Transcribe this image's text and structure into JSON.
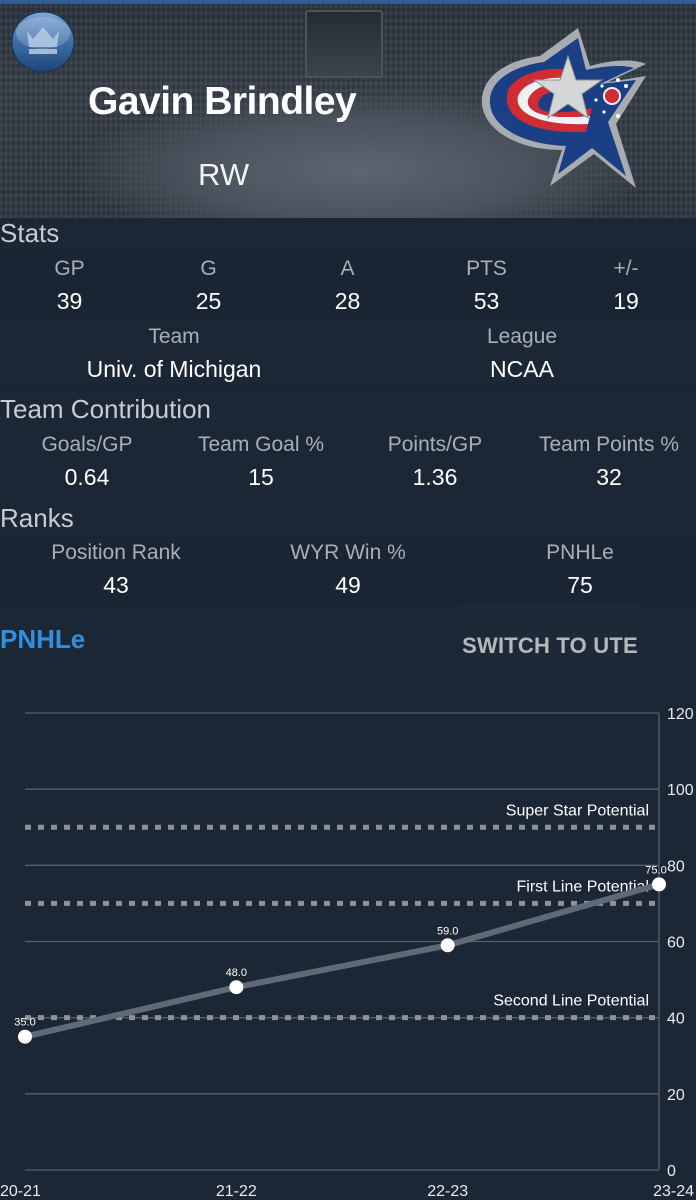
{
  "player": {
    "name": "Gavin Brindley",
    "position": "RW"
  },
  "app": {
    "logo_icon": "crown-puck-icon",
    "team_logo_icon": "columbus-blue-jackets-logo"
  },
  "stats": {
    "title": "Stats",
    "columns": [
      {
        "label": "GP",
        "value": "39"
      },
      {
        "label": "G",
        "value": "25"
      },
      {
        "label": "A",
        "value": "28"
      },
      {
        "label": "PTS",
        "value": "53"
      },
      {
        "label": "+/-",
        "value": "19"
      }
    ],
    "team_label": "Team",
    "team_value": "Univ. of Michigan",
    "league_label": "League",
    "league_value": "NCAA"
  },
  "contribution": {
    "title": "Team Contribution",
    "columns": [
      {
        "label": "Goals/GP",
        "value": "0.64"
      },
      {
        "label": "Team Goal %",
        "value": "15"
      },
      {
        "label": "Points/GP",
        "value": "1.36"
      },
      {
        "label": "Team Points %",
        "value": "32"
      }
    ]
  },
  "ranks": {
    "title": "Ranks",
    "columns": [
      {
        "label": "Position Rank",
        "value": "43"
      },
      {
        "label": "WYR Win %",
        "value": "49"
      },
      {
        "label": "PNHLe",
        "value": "75"
      }
    ]
  },
  "tabs": {
    "active": "PNHLe",
    "switch_label": "SWITCH TO UTE"
  },
  "colors": {
    "background": "#1c2735",
    "accent": "#2f8fe0",
    "line": "#5e6a76",
    "reference": "#8e9296"
  },
  "chart_data": {
    "type": "line",
    "title": "PNHLe",
    "categories": [
      "20-21",
      "21-22",
      "22-23",
      "23-24"
    ],
    "series": [
      {
        "name": "PNHLe",
        "values": [
          35.0,
          48.0,
          59.0,
          75.0
        ],
        "labels": [
          "35.0",
          "48.0",
          "59.0",
          "75.0"
        ]
      }
    ],
    "reference_lines": [
      {
        "name": "Super Star Potential",
        "value": 90
      },
      {
        "name": "First Line Potential",
        "value": 70
      },
      {
        "name": "Second Line Potential",
        "value": 40
      }
    ],
    "yticks": [
      0,
      20,
      40,
      60,
      80,
      100,
      120
    ],
    "ylim": [
      0,
      120
    ],
    "xlabel": "",
    "ylabel": "",
    "y_axis_side": "right",
    "grid": true,
    "legend": "none"
  }
}
